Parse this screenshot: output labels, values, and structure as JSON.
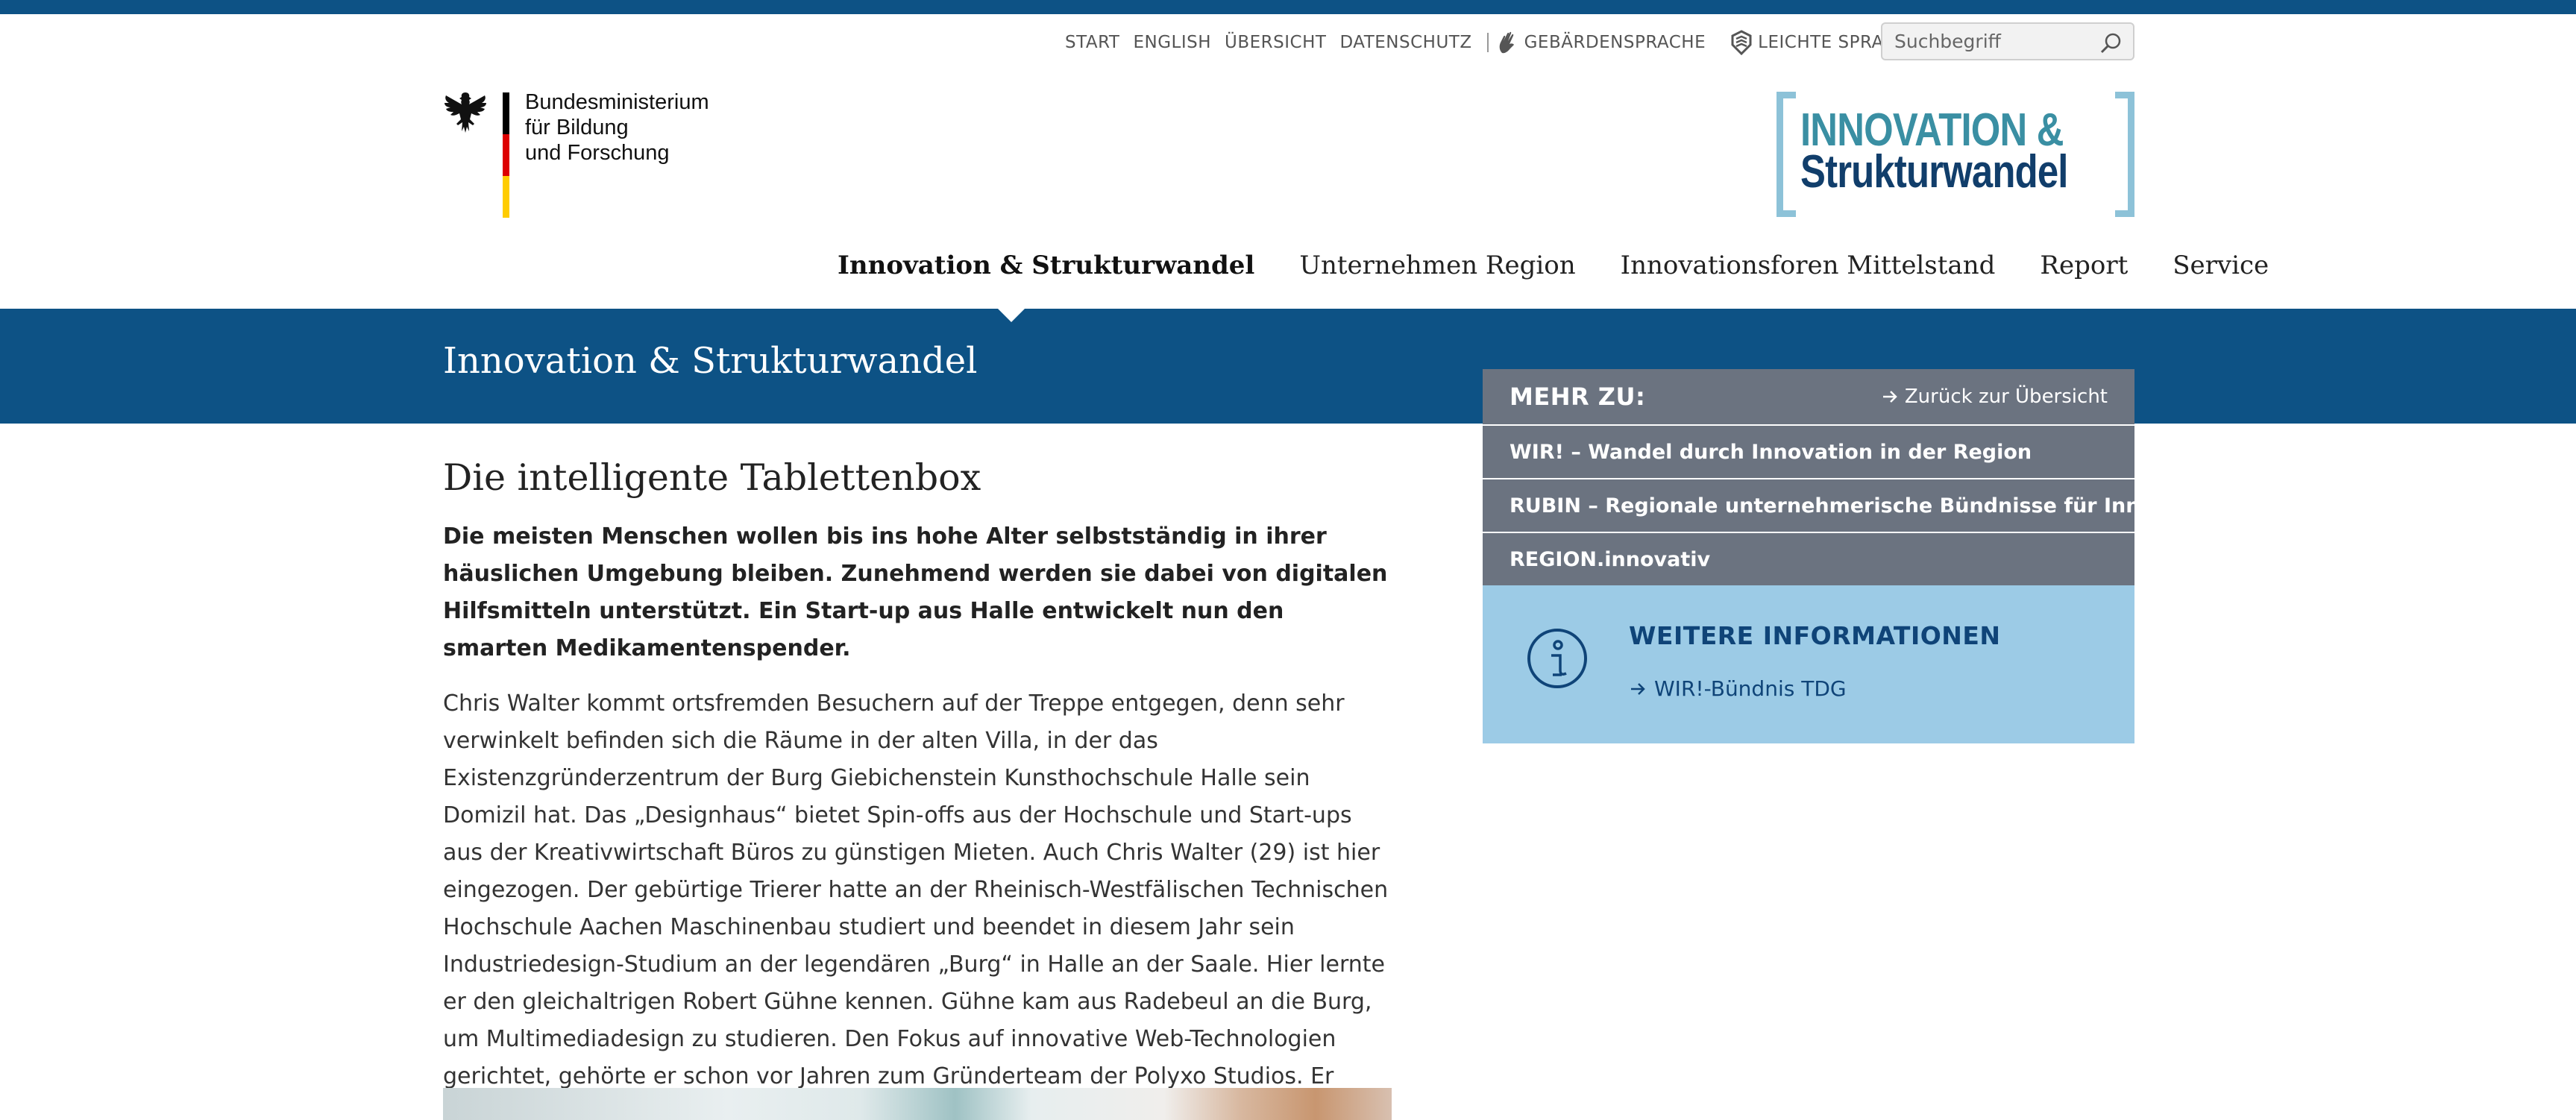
{
  "meta_nav": {
    "items": [
      "START",
      "ENGLISH",
      "ÜBERSICHT",
      "DATENSCHUTZ"
    ],
    "sign_language": "GEBÄRDENSPRACHE",
    "easy_language": "LEICHTE SPRACHE"
  },
  "search": {
    "placeholder": "Suchbegriff"
  },
  "bmbf_logo": {
    "line1": "Bundesministerium",
    "line2": "für Bildung",
    "line3": "und Forschung",
    "flag_colors": [
      "#000000",
      "#dd0000",
      "#ffcc00"
    ]
  },
  "site_logo": {
    "line1": "INNOVATION &",
    "line2": "Strukturwandel"
  },
  "main_nav": {
    "items": [
      "Innovation & Strukturwandel",
      "Unternehmen Region",
      "Innovationsforen Mittelstand",
      "Report",
      "Service"
    ],
    "active": "Innovation & Strukturwandel"
  },
  "banner": {
    "title": "Innovation & Strukturwandel"
  },
  "article": {
    "title": "Die intelligente Tablettenbox",
    "lead": "Die meisten Menschen wollen bis ins hohe Alter selbstständig in ihrer häuslichen Umgebung bleiben. Zunehmend werden sie dabei von digitalen Hilfsmitteln unterstützt. Ein Start-up aus Halle entwickelt nun den smarten Medikamentenspender.",
    "body": "Chris Walter kommt ortsfremden Besuchern auf der Treppe entgegen, denn sehr verwinkelt befinden sich die Räume in der alten Villa, in der das Existenzgründerzentrum der Burg Giebichenstein Kunsthochschule Halle sein Domizil hat. Das „Designhaus“ bietet Spin-offs aus der Hochschule und Start-ups aus der Kreativwirtschaft Büros zu günstigen Mieten. Auch Chris Walter (29) ist hier eingezogen. Der gebürtige Trierer hatte an der Rheinisch-Westfälischen Technischen Hochschule Aachen Maschinenbau studiert und beendet in diesem Jahr sein Industriedesign-Studium an der legendären „Burg“ in Halle an der Saale. Hier lernte er den gleichaltrigen Robert Gühne kennen. Gühne kam aus Radebeul an die Burg, um Multimediadesign zu studieren. Den Fokus auf innovative Web-Technologien gerichtet, gehörte er schon vor Jahren zum Gründerteam der Polyxo Studios. Er entwickelt unter anderem Softwarekonzepte für das Welternährungsprogramm der Vereinten Nationen."
  },
  "sidebar": {
    "mehr_title": "MEHR ZU:",
    "back_label": "Zurück zur Übersicht",
    "items": [
      "WIR! – Wandel durch Innovation in der Region",
      "RUBIN – Regionale unternehmerische Bündnisse für Innovation",
      "REGION.innovativ"
    ],
    "info_title": "WEITERE INFORMATIONEN",
    "info_link": "WIR!-Bündnis TDG"
  },
  "colors": {
    "brand_blue": "#0d5285",
    "sidebar_gray": "#6b7380",
    "info_bg": "#9ccbe6",
    "info_text": "#0f4478",
    "logo_teal": "#3a8fa3",
    "logo_navy": "#113e6b",
    "logo_bracket": "#8dc2d8"
  }
}
